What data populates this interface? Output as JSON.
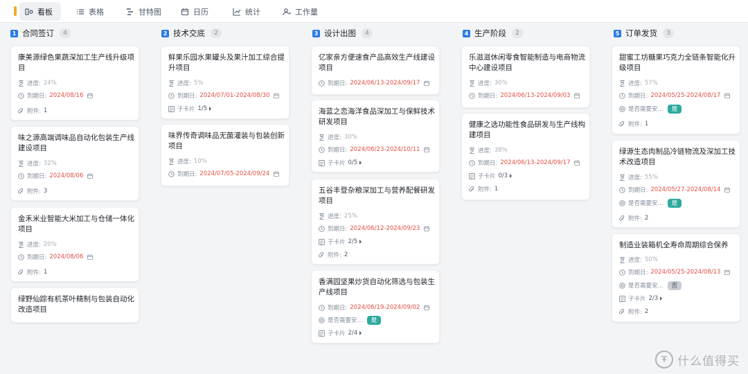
{
  "tabs": [
    {
      "label": "看板",
      "icon": "kanban-icon",
      "active": true
    },
    {
      "label": "表格",
      "icon": "list-icon",
      "active": false
    },
    {
      "label": "甘特图",
      "icon": "gantt-icon",
      "active": false
    },
    {
      "label": "日历",
      "icon": "calendar-icon",
      "active": false
    },
    {
      "label": "统计",
      "icon": "chart-icon",
      "active": false
    },
    {
      "label": "工作量",
      "icon": "workload-icon",
      "active": false
    }
  ],
  "labels": {
    "progress": "进度:",
    "due": "到期日:",
    "attachment": "附件:",
    "subcard": "子卡片",
    "need_safety": "是否需要安...",
    "yes": "是",
    "no": "否"
  },
  "columns": [
    {
      "num": "1",
      "title": "合同签订",
      "count": "4",
      "cards": [
        {
          "title": "康美源绿色果蔬深加工生产线升级项目",
          "progress": "24%",
          "due": "2024/08/16",
          "attachments": "1"
        },
        {
          "title": "味之源高端调味品自动化包装生产线建设项目",
          "progress": "32%",
          "due": "2024/08/06",
          "attachments": "3"
        },
        {
          "title": "金禾米业智能大米加工与仓储一体化项目",
          "progress": "20%",
          "due": "2024/08/06",
          "attachments": "1"
        },
        {
          "title": "绿野仙踪有机茶叶精制与包装自动化改造项目"
        }
      ]
    },
    {
      "num": "2",
      "title": "技术交底",
      "count": "2",
      "cards": [
        {
          "title": "鲜果乐园水果罐头及果汁加工综合提升项目",
          "progress": "5%",
          "due": "2024/07/01-2024/08/30",
          "subcards": "1/5"
        },
        {
          "title": "味界传奇调味品无菌灌装与包装创新项目",
          "progress": "10%",
          "due": "2024/07/05-2024/09/24"
        }
      ]
    },
    {
      "num": "3",
      "title": "设计出图",
      "count": "4",
      "cards": [
        {
          "title": "亿家亲方便速食产品高效生产线建设项目",
          "due": "2024/06/13-2024/09/17"
        },
        {
          "title": "海蓝之恋海洋食品深加工与保鲜技术研发项目",
          "progress": "30%",
          "due": "2024/06/23-2024/10/11",
          "subcards": "0/5"
        },
        {
          "title": "五谷丰登杂粮深加工与营养配餐研发项目",
          "progress": "25%",
          "due": "2024/06/12-2024/09/23",
          "subcards": "2/5",
          "attachments": "2"
        },
        {
          "title": "香满园坚果炒货自动化筛选与包装生产线项目",
          "due": "2024/06/19-2024/09/02",
          "safety": "是",
          "subcards": "2/4"
        }
      ]
    },
    {
      "num": "4",
      "title": "生产阶段",
      "count": "2",
      "cards": [
        {
          "title": "乐滋滋休闲零食智能制造与电商物流中心建设项目",
          "progress": "30%",
          "due": "2024/06/13-2024/09/03"
        },
        {
          "title": "健康之选功能性食品研发与生产线构建项目",
          "progress": "38%",
          "due": "2024/06/13-2024/09/17",
          "subcards": "0/3",
          "attachments": "1"
        }
      ]
    },
    {
      "num": "5",
      "title": "订单发货",
      "count": "3",
      "cards": [
        {
          "title": "甜蜜工坊糖果巧克力全链条智能化升级项目",
          "progress": "57%",
          "due": "2024/05/25-2024/08/17",
          "safety": "是",
          "attachments": "1"
        },
        {
          "title": "绿源生态肉制品冷链物流及深加工技术改造项目",
          "progress": "55%",
          "due": "2024/05/27-2024/08/14",
          "safety": "是",
          "attachments": "2"
        },
        {
          "title": "制造业装箱机全寿命周期综合保养",
          "progress": "50%",
          "due": "2024/05/25-2024/08/13",
          "safety": "否",
          "subcards": "2/3",
          "attachments": "2"
        }
      ]
    }
  ],
  "watermark": "什么值得买",
  "colors": {
    "accent": "#2b7be5",
    "due_red": "#e34d42",
    "badge_teal": "#2fa9a0",
    "badge_grey": "#c9cdd4"
  }
}
